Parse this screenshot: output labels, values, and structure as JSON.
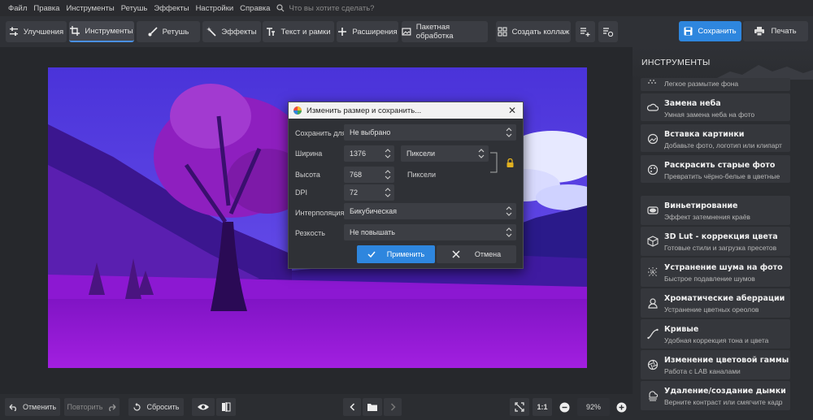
{
  "menu": {
    "items": [
      "Файл",
      "Правка",
      "Инструменты",
      "Ретушь",
      "Эффекты",
      "Настройки",
      "Справка"
    ],
    "search_placeholder": "Что вы хотите сделать?"
  },
  "toolbar": {
    "tabs": [
      {
        "label": "Улучшения"
      },
      {
        "label": "Инструменты"
      },
      {
        "label": "Ретушь"
      },
      {
        "label": "Эффекты"
      },
      {
        "label": "Текст и рамки"
      },
      {
        "label": "Расширения"
      },
      {
        "label": "Пакетная обработка"
      },
      {
        "label": "Создать коллаж"
      }
    ],
    "save_label": "Сохранить",
    "print_label": "Печать"
  },
  "dialog": {
    "title": "Изменить размер и сохранить...",
    "save_for_label": "Сохранить для",
    "save_for_value": "Не выбрано",
    "width_label": "Ширина",
    "width_value": "1376",
    "units_value": "Пиксели",
    "height_label": "Высота",
    "height_value": "768",
    "height_units": "Пиксели",
    "dpi_label": "DPI",
    "dpi_value": "72",
    "interp_label": "Интерполяция",
    "interp_value": "Бикубическая",
    "sharp_label": "Резкость",
    "sharp_value": "Не повышать",
    "apply_label": "Применить",
    "cancel_label": "Отмена"
  },
  "panel": {
    "title": "ИНСТРУМЕНТЫ",
    "cards": [
      {
        "title": "",
        "desc": "Легкое размытие фона"
      },
      {
        "title": "Замена неба",
        "desc": "Умная замена неба на фото"
      },
      {
        "title": "Вставка картинки",
        "desc": "Добавьте фото, логотип или клипарт"
      },
      {
        "title": "Раскрасить старые фото",
        "desc": "Превратить чёрно-белые в цветные"
      },
      {
        "title": "Виньетирование",
        "desc": "Эффект затемнения краёв"
      },
      {
        "title": "3D Lut - коррекция цвета",
        "desc": "Готовые стили и загрузка пресетов"
      },
      {
        "title": "Устранение шума на фото",
        "desc": "Быстрое подавление шумов"
      },
      {
        "title": "Хроматические аберрации",
        "desc": "Устранение цветных ореолов"
      },
      {
        "title": "Кривые",
        "desc": "Удобная коррекция тона и цвета"
      },
      {
        "title": "Изменение цветовой гаммы",
        "desc": "Работа с LAB каналами"
      },
      {
        "title": "Удаление/создание дымки",
        "desc": "Верните контраст или смягчите кадр"
      }
    ]
  },
  "bottom": {
    "undo_label": "Отменить",
    "redo_label": "Повторить",
    "reset_label": "Сбросить",
    "ratio_label": "1:1",
    "zoom_value": "92%"
  },
  "colors": {
    "accent": "#2e86de",
    "sky": "#5a3fe0",
    "meadow": "#9a1bd6"
  }
}
